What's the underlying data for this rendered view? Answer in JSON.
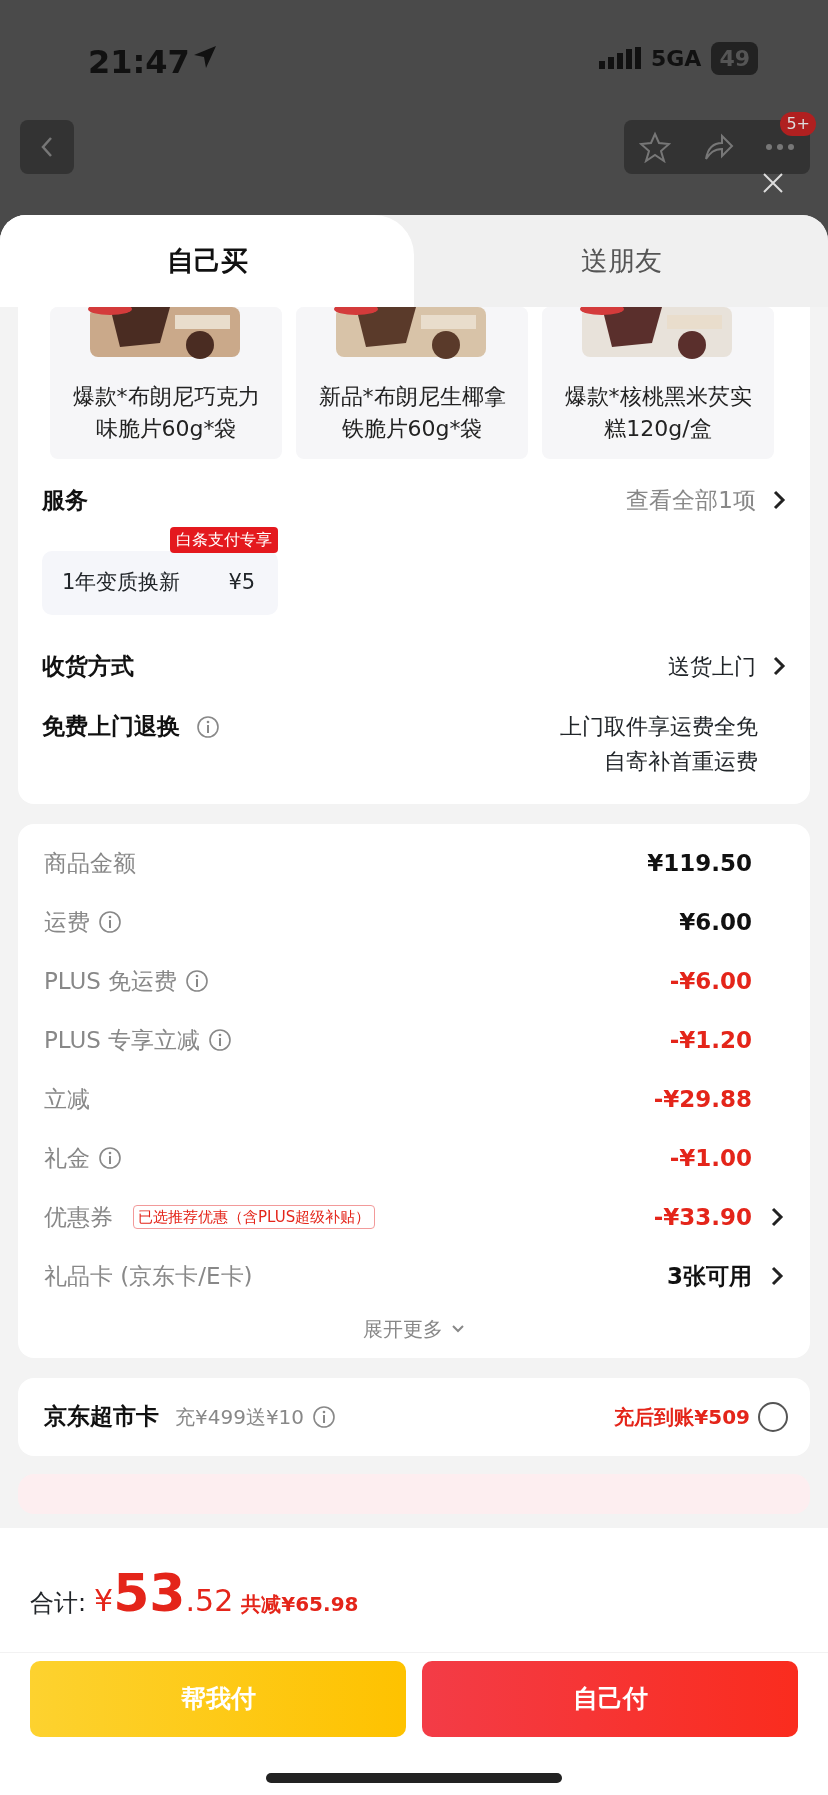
{
  "status_bar": {
    "time": "21:47",
    "network": "5GA",
    "battery": "49"
  },
  "nav": {
    "badge": "5+"
  },
  "tabs": [
    {
      "label": "自己买",
      "selected": true
    },
    {
      "label": "送朋友",
      "selected": false
    }
  ],
  "products": [
    {
      "name": "爆款*布朗尼巧克力味脆片60g*袋"
    },
    {
      "name": "新品*布朗尼生椰拿铁脆片60g*袋"
    },
    {
      "name": "爆款*核桃黑米芡实糕120g/盒"
    }
  ],
  "services": {
    "title": "服务",
    "link": "查看全部1项",
    "chip": {
      "name": "1年变质换新",
      "price": "¥5",
      "tag": "白条支付专享"
    }
  },
  "delivery": {
    "label": "收货方式",
    "value": "送货上门"
  },
  "returns": {
    "label": "免费上门退换",
    "lines": [
      "上门取件享运费全免",
      "自寄补首重运费"
    ]
  },
  "price_rows": [
    {
      "label": "商品金额",
      "info": false,
      "value": "¥119.50",
      "discount": false,
      "chevron": false
    },
    {
      "label": "运费",
      "info": true,
      "value": "¥6.00",
      "discount": false,
      "chevron": false
    },
    {
      "label": "PLUS 免运费",
      "info": true,
      "value": "-¥6.00",
      "discount": true,
      "chevron": false
    },
    {
      "label": "PLUS 专享立减",
      "info": true,
      "value": "-¥1.20",
      "discount": true,
      "chevron": false
    },
    {
      "label": "立减",
      "info": false,
      "value": "-¥29.88",
      "discount": true,
      "chevron": false
    },
    {
      "label": "礼金",
      "info": true,
      "value": "-¥1.00",
      "discount": true,
      "chevron": false
    },
    {
      "label": "优惠券",
      "info": false,
      "tag": "已选推荐优惠（含PLUS超级补贴）",
      "value": "-¥33.90",
      "discount": true,
      "chevron": true
    },
    {
      "label": "礼品卡 (京东卡/E卡)",
      "info": false,
      "value": "3张可用",
      "discount": false,
      "chevron": true
    }
  ],
  "expand": "展开更多",
  "supermarket_card": {
    "title": "京东超市卡",
    "offer": "充¥499送¥10",
    "result": "充后到账¥509",
    "selected": false
  },
  "footer": {
    "total_label": "合计:",
    "currency": "¥",
    "total_int": "53",
    "total_dec": ".52",
    "saving": "共减¥65.98",
    "buttons": [
      "帮我付",
      "自己付"
    ]
  }
}
